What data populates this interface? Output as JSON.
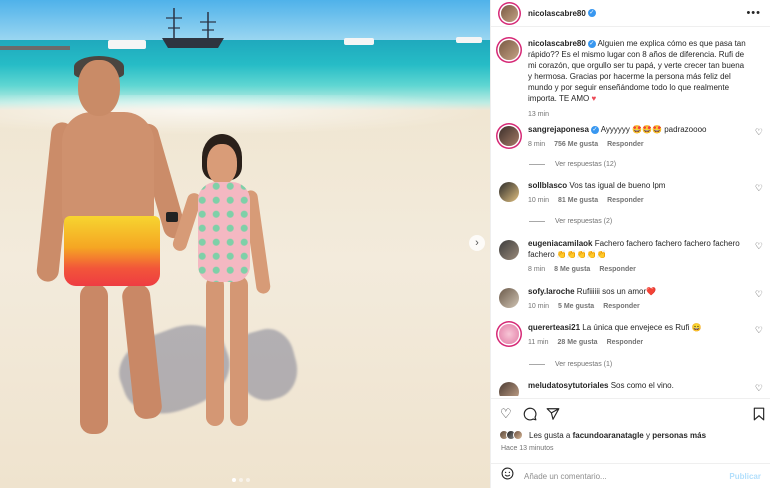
{
  "post": {
    "username": "nicolascabre80",
    "verified": true,
    "caption": "Alguien me explica cómo es que pasa tan rápido?? Es el mismo lugar con 8 años de diferencia. Rufi de mi corazón, que orgullo ser tu papá, y verte crecer tan buena y hermosa. Gracias por hacerme la persona más feliz del mundo y por seguir enseñándome todo lo que realmente importa. TE AMO",
    "caption_time": "13 min",
    "carousel_total_dots": 3,
    "carousel_active": 1
  },
  "comments": [
    {
      "user": "sangrejaponesa",
      "verified": true,
      "text": "Ayyyyyy 🤩🤩🤩 padrazoooo",
      "time": "8 min",
      "likes": "756 Me gusta",
      "reply": "Responder",
      "view_replies": "Ver respuestas (12)"
    },
    {
      "user": "sollblasco",
      "verified": false,
      "text": "Vos tas igual de bueno lpm",
      "time": "10 min",
      "likes": "81 Me gusta",
      "reply": "Responder",
      "view_replies": "Ver respuestas (2)"
    },
    {
      "user": "eugeniacamilaok",
      "verified": false,
      "text": "Fachero fachero fachero fachero fachero fachero 👏👏👏👏👏",
      "time": "8 min",
      "likes": "8 Me gusta",
      "reply": "Responder",
      "view_replies": ""
    },
    {
      "user": "sofy.laroche",
      "verified": false,
      "text": "Rufiiiiii sos un amor❤️",
      "time": "10 min",
      "likes": "5 Me gusta",
      "reply": "Responder",
      "view_replies": ""
    },
    {
      "user": "quererteasi21",
      "verified": false,
      "text": "La única que envejece es Rufi 😄",
      "time": "11 min",
      "likes": "28 Me gusta",
      "reply": "Responder",
      "view_replies": "Ver respuestas (1)"
    },
    {
      "user": "meludatosytutoriales",
      "verified": false,
      "text": "Sos como el vino.",
      "time": "",
      "likes": "",
      "reply": "",
      "view_replies": ""
    }
  ],
  "likes_line": {
    "prefix": "Les gusta a",
    "user": "facundoaranatagle",
    "suffix": "y",
    "others": "personas más"
  },
  "posted_ago": "Hace 13 minutos",
  "add_comment": {
    "placeholder": "Añade un comentario...",
    "post_label": "Publicar"
  },
  "icons": {
    "like": "heart-icon",
    "comment": "comment-icon",
    "share": "send-icon",
    "save": "bookmark-icon",
    "more": "more-icon",
    "emoji": "emoji-icon",
    "next": "chevron-right-icon"
  },
  "colors": {
    "verified": "#3897f0",
    "link_blue": "#b2dffc",
    "heart": "#ed4956"
  }
}
